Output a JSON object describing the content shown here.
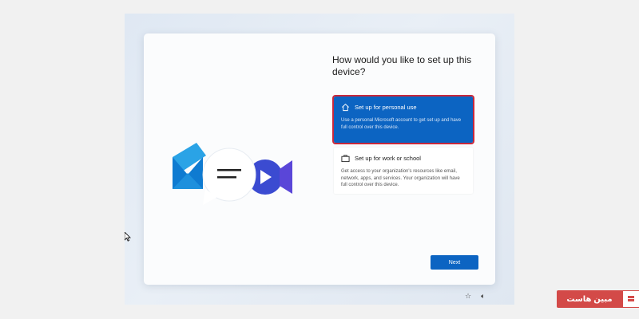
{
  "setup": {
    "title": "How would you like to set up this device?",
    "options": [
      {
        "label": "Set up for personal use",
        "description": "Use a personal Microsoft account to get set up and have full control over this device.",
        "icon": "home-icon",
        "selected": true
      },
      {
        "label": "Set up for work or school",
        "description": "Get access to your organization's resources like email, network, apps, and services. Your organization will have full control over this device.",
        "icon": "briefcase-icon",
        "selected": false
      }
    ],
    "next_label": "Next"
  },
  "watermark": {
    "text": "مبین هاست"
  },
  "colors": {
    "accent": "#0c64c2",
    "selection_outline": "#c8283c",
    "brand": "#d34a48"
  }
}
